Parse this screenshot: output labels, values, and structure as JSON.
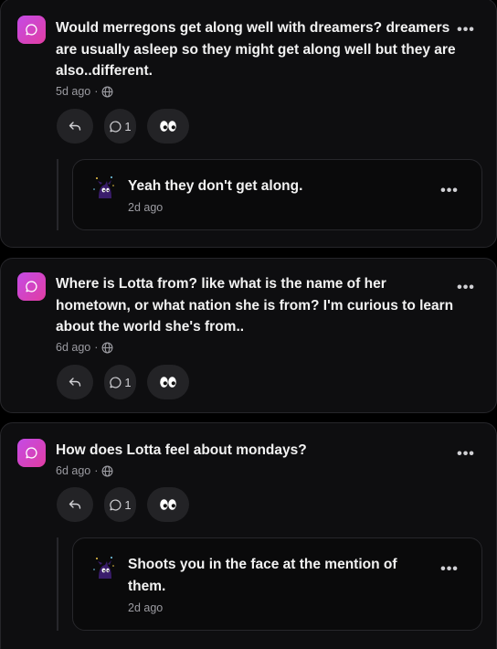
{
  "posts": [
    {
      "question": "Would merregons get along well with dreamers? dreamers are usually asleep so they might get along well but they are also..different.",
      "time": "5d ago",
      "separator": "·",
      "comment_count": "1",
      "answer": {
        "text": "Yeah they don't get along.",
        "time": "2d ago"
      }
    },
    {
      "question": "Where is Lotta from? like what is the name of her hometown, or what nation she is from? I'm curious to learn about the world she's from..",
      "time": "6d ago",
      "separator": "·",
      "comment_count": "1"
    },
    {
      "question": "How does Lotta feel about mondays?",
      "time": "6d ago",
      "separator": "·",
      "comment_count": "1",
      "answer": {
        "text": "Shoots you in the face at the mention of them.",
        "time": "2d ago"
      }
    }
  ],
  "colors": {
    "accent_gradient_start": "#c44be6",
    "accent_gradient_end": "#e13da2",
    "card_bg": "#0e0e10",
    "pill_bg": "#232326"
  },
  "icons": [
    "chat-bubble-icon",
    "globe-icon",
    "reply-arrow-icon",
    "comment-icon",
    "eyes-icon",
    "more-options-icon",
    "creature-avatar-icon"
  ]
}
